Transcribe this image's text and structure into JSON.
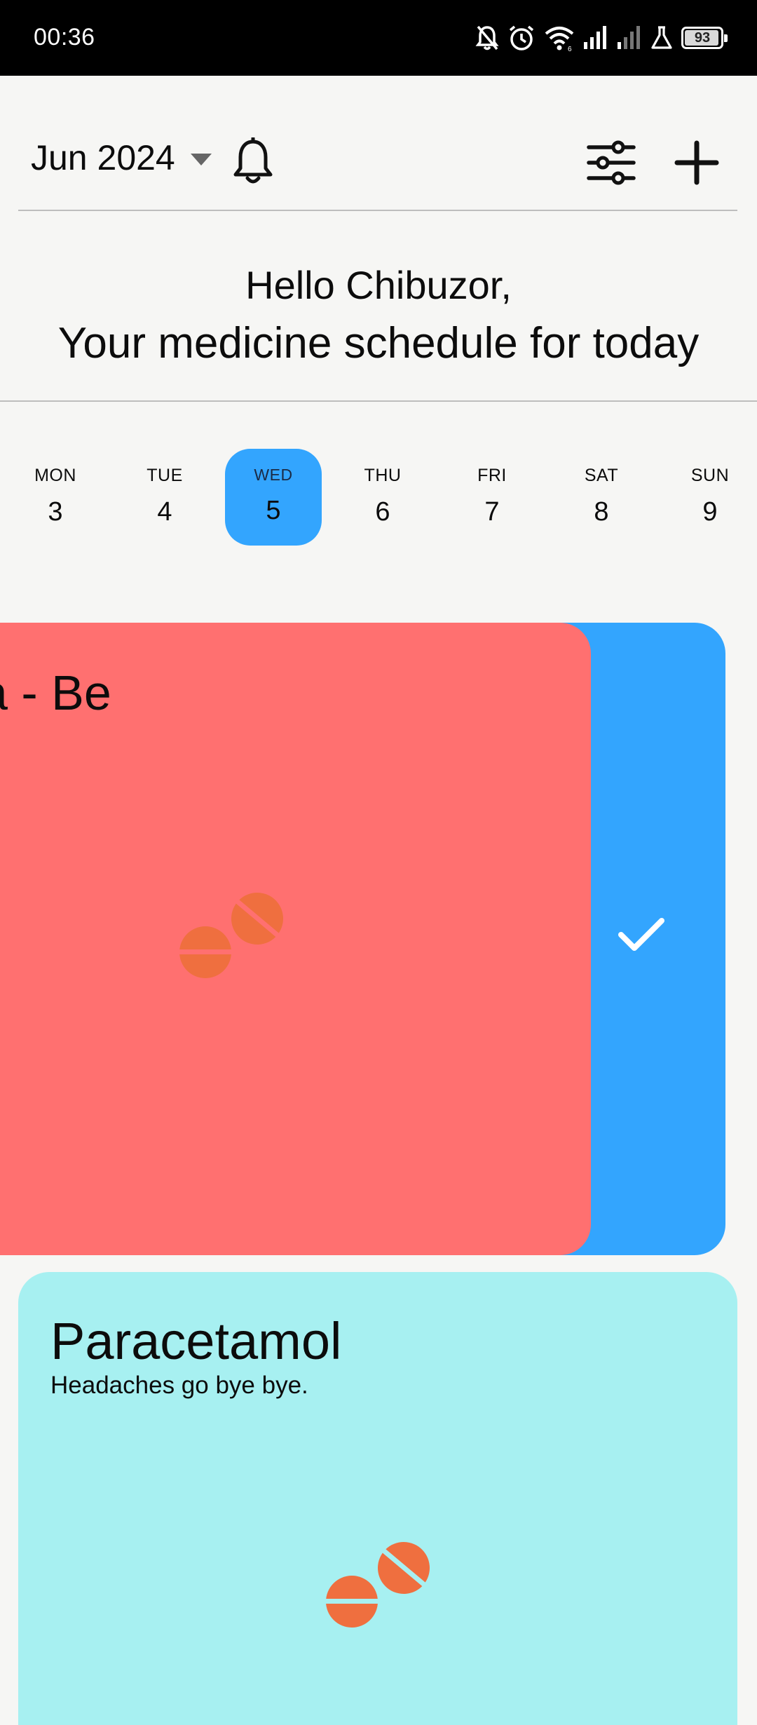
{
  "status_bar": {
    "time": "00:36",
    "battery": "93",
    "icons": [
      "notifications-off-icon",
      "alarm-icon",
      "wifi-icon",
      "signal-icon",
      "signal-weak-icon",
      "lab-icon",
      "battery-icon"
    ]
  },
  "header": {
    "month": "Jun 2024",
    "icons": [
      "dropdown-caret-icon",
      "bell-icon",
      "filter-icon",
      "add-icon"
    ]
  },
  "greeting": {
    "line1": "Hello Chibuzor,",
    "line2": "Your medicine schedule for today"
  },
  "week": {
    "selected_index": 2,
    "days": [
      {
        "name": "MON",
        "num": "3"
      },
      {
        "name": "TUE",
        "num": "4"
      },
      {
        "name": "WED",
        "num": "5"
      },
      {
        "name": "THU",
        "num": "6"
      },
      {
        "name": "FRI",
        "num": "7"
      },
      {
        "name": "SAT",
        "num": "8"
      },
      {
        "name": "SUN",
        "num": "9"
      }
    ]
  },
  "cards": [
    {
      "title": "a - Be",
      "color": "#ff7070",
      "action_color": "#33a5fe",
      "action_icon": "check-icon",
      "icon": "pills-icon"
    },
    {
      "title": "Paracetamol",
      "subtitle": "Headaches go bye bye.",
      "color": "#a7f0f1",
      "icon": "pills-icon"
    }
  ],
  "colors": {
    "accent": "#33a5fe",
    "pill": "#ef6f3f"
  }
}
